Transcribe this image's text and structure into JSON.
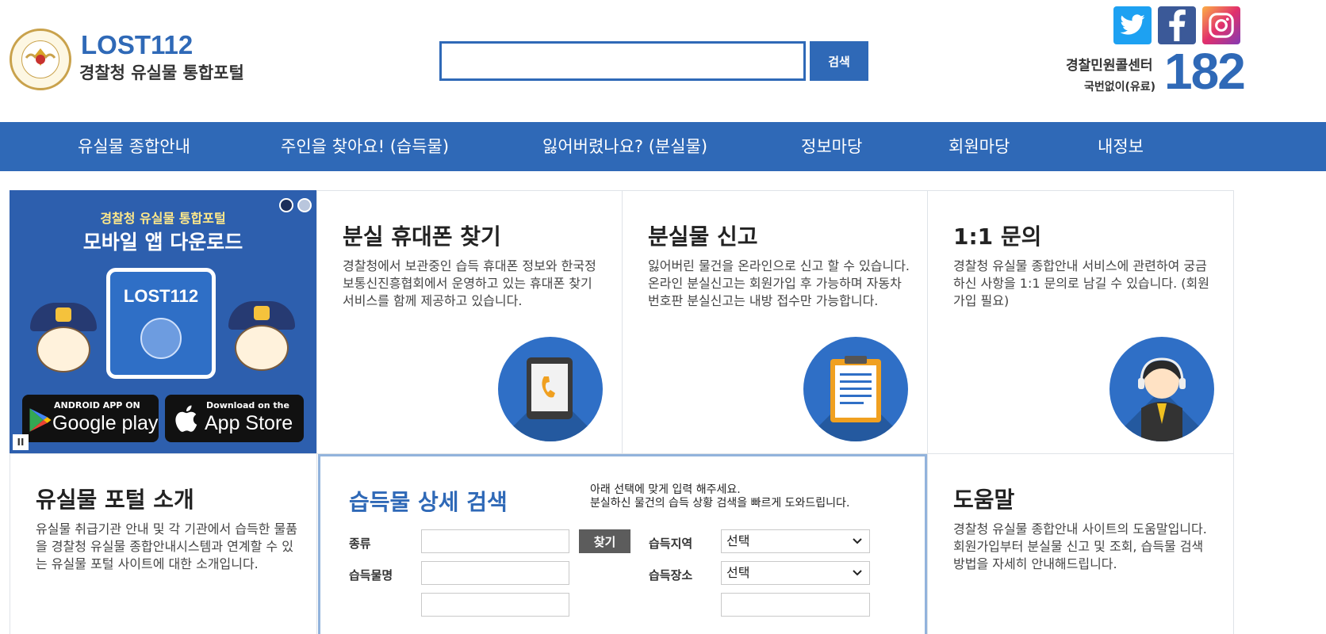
{
  "header": {
    "logo_title": "LOST112",
    "logo_subtitle": "경찰청 유실물 통합포털",
    "search_button": "검색",
    "search_placeholder": "",
    "social": {
      "twitter": "t",
      "facebook": "f",
      "instagram": "◎"
    },
    "call_center_label": "경찰민원콜센터",
    "call_center_note": "국번없이(유료)",
    "call_center_number": "182"
  },
  "nav": {
    "items": [
      {
        "label": "유실물 종합안내"
      },
      {
        "label": "주인을 찾아요! (습득물)"
      },
      {
        "label": "잃어버렸나요? (분실물)"
      },
      {
        "label": "정보마당"
      },
      {
        "label": "회원마당"
      },
      {
        "label": "내정보"
      }
    ]
  },
  "banner": {
    "line1": "경찰청 유실물 통합포털",
    "line2": "모바일 앱 다운로드",
    "card_title": "LOST112",
    "google_small": "ANDROID APP ON",
    "google_big": "Google play",
    "apple_small": "Download on the",
    "apple_big": "App Store",
    "pause": "II"
  },
  "cards": [
    {
      "title": "분실 휴대폰 찾기",
      "desc": "경찰청에서 보관중인 습득 휴대폰 정보와 한국정보통신진흥협회에서 운영하고 있는 휴대폰 찾기 서비스를 함께 제공하고 있습니다.",
      "icon": "tablet-phone-icon"
    },
    {
      "title": "분실물 신고",
      "desc": "잃어버린 물건을 온라인으로 신고 할 수 있습니다. 온라인 분실신고는 회원가입 후 가능하며 자동차 번호판 분실신고는 내방 접수만 가능합니다.",
      "icon": "clipboard-icon"
    },
    {
      "title": "1:1 문의",
      "desc": "경찰청 유실물 종합안내 서비스에 관련하여 궁금하신 사항을 1:1 문의로 남길 수 있습니다. (회원가입 필요)",
      "icon": "operator-icon"
    },
    {
      "title": "유실물 포털 소개",
      "desc": "유실물 취급기관 안내 및 각 기관에서 습득한 물품을 경찰청 유실물 종합안내시스템과 연계할 수 있는 유실물 포털 사이트에 대한 소개입니다."
    },
    {
      "title": "도움말",
      "desc": "경찰청 유실물 종합안내 사이트의 도움말입니다. 회원가입부터 분실물 신고 및 조회, 습득물 검색 방법을 자세히 안내해드립니다."
    }
  ],
  "search_panel": {
    "title": "습득물 상세 검색",
    "help_line1": "아래 선택에 맞게 입력 해주세요.",
    "help_line2": "분실하신 물건의 습득 상황 검색을 빠르게 도와드립니다.",
    "label_type": "종류",
    "find_button": "찾기",
    "label_item_name": "습득물명",
    "label_region": "습득지역",
    "label_place": "습득장소",
    "region_value": "선택",
    "place_value": "선택"
  },
  "colors": {
    "brand_blue": "#2f69b7",
    "nav_bg": "#2f69b7",
    "panel_border": "#92b3dc"
  }
}
